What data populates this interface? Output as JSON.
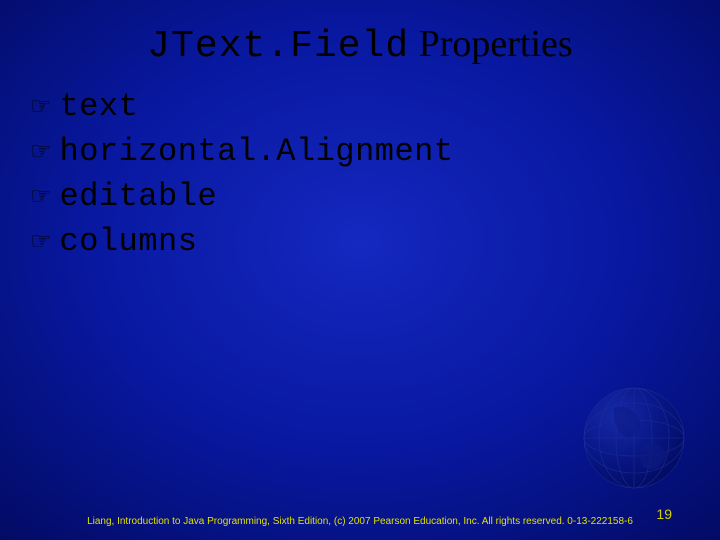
{
  "title": {
    "code": "JText.Field",
    "rest": " Properties"
  },
  "bullets": [
    {
      "label": "text"
    },
    {
      "label": "horizontal.Alignment"
    },
    {
      "label": "editable"
    },
    {
      "label": "columns"
    }
  ],
  "footer": "Liang, Introduction to Java Programming, Sixth Edition, (c) 2007 Pearson Education, Inc. All rights reserved. 0-13-222158-6",
  "page_number": "19"
}
